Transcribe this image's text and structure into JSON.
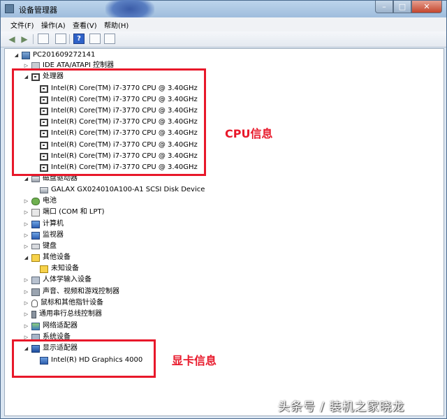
{
  "window": {
    "title": "设备管理器"
  },
  "menu": [
    {
      "label": "文件(F)"
    },
    {
      "label": "操作(A)"
    },
    {
      "label": "查看(V)"
    },
    {
      "label": "帮助(H)"
    }
  ],
  "tree": {
    "root": "PC201609272141",
    "ide": "IDE ATA/ATAPI 控制器",
    "processors": {
      "label": "处理器",
      "items": [
        "Intel(R) Core(TM) i7-3770 CPU @ 3.40GHz",
        "Intel(R) Core(TM) i7-3770 CPU @ 3.40GHz",
        "Intel(R) Core(TM) i7-3770 CPU @ 3.40GHz",
        "Intel(R) Core(TM) i7-3770 CPU @ 3.40GHz",
        "Intel(R) Core(TM) i7-3770 CPU @ 3.40GHz",
        "Intel(R) Core(TM) i7-3770 CPU @ 3.40GHz",
        "Intel(R) Core(TM) i7-3770 CPU @ 3.40GHz",
        "Intel(R) Core(TM) i7-3770 CPU @ 3.40GHz"
      ]
    },
    "disk": {
      "label": "磁盘驱动器",
      "item": "GALAX GX024010A100-A1 SCSI Disk Device"
    },
    "battery": "电池",
    "ports": "端口 (COM 和 LPT)",
    "computer": "计算机",
    "monitors": "监视器",
    "keyboards": "键盘",
    "other": {
      "label": "其他设备",
      "item": "未知设备"
    },
    "hid": "人体学输入设备",
    "sound": "声音、视频和游戏控制器",
    "mice": "鼠标和其他指针设备",
    "usb": "通用串行总线控制器",
    "network": "网络适配器",
    "system": "系统设备",
    "display": {
      "label": "显示适配器",
      "item": "Intel(R) HD Graphics 4000"
    }
  },
  "annotations": {
    "cpu": "CPU信息",
    "gpu": "显卡信息"
  },
  "watermark": "头条号 / 装机之家晓龙",
  "colors": {
    "highlight": "#e8182a",
    "titlebar": "#9fbddc"
  }
}
